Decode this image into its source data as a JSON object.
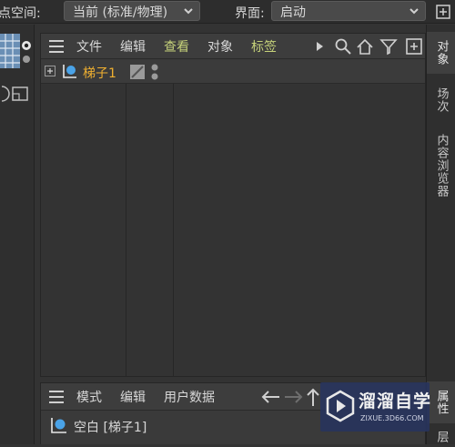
{
  "topbar": {
    "coord_label": "点空间:",
    "coord_value": "当前 (标准/物理)",
    "layout_label": "界面:",
    "layout_value": "启动"
  },
  "object_manager": {
    "menus": [
      "文件",
      "编辑",
      "查看",
      "对象",
      "标签"
    ],
    "toolbar_icons": [
      "play-triangle-icon",
      "search-icon",
      "home-icon",
      "filter-icon",
      "add-panel-icon"
    ],
    "objects": [
      {
        "name": "梯子1",
        "icon": "null-object-icon"
      }
    ]
  },
  "right_tabs": [
    {
      "label": "对象",
      "active": true
    },
    {
      "label": "场次",
      "active": false
    },
    {
      "label": "内容浏览器",
      "active": false
    },
    {
      "label": "属性",
      "active": true
    },
    {
      "label": "层",
      "active": false
    }
  ],
  "attribute_manager": {
    "menus": [
      "模式",
      "编辑",
      "用户数据"
    ],
    "selected_object": "空白 [梯子1]"
  },
  "watermark": {
    "title": "溜溜自学",
    "url": "ZIXUE.3D66.COM"
  },
  "colors": {
    "highlight_menu": "#c6d27a",
    "object_name": "#f0b030",
    "accent_blue": "#4aa3e8"
  }
}
